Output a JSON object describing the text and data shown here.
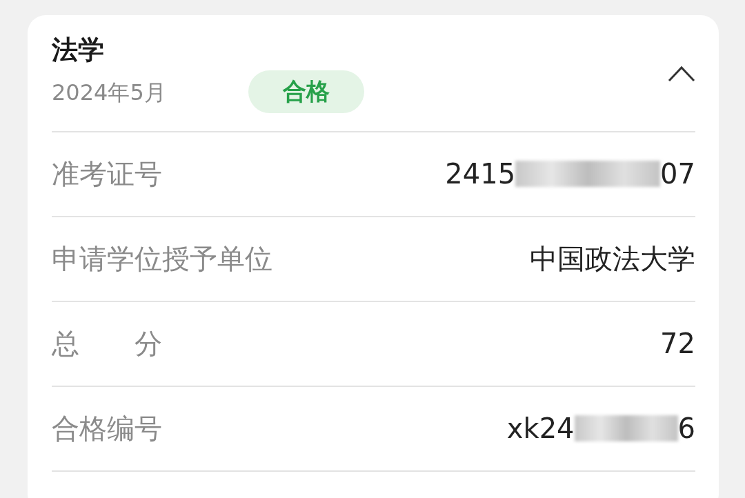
{
  "card": {
    "title": "法学",
    "date": "2024年5月",
    "badge": "合格",
    "expanded": true,
    "rows": [
      {
        "label": "准考证号",
        "value_start": "2415",
        "redacted": true,
        "value_end": "07"
      },
      {
        "label": "申请学位授予单位",
        "value_start": "中国政法大学",
        "redacted": false
      },
      {
        "label": "总　　分",
        "value_start": "72",
        "redacted": false
      },
      {
        "label": "合格编号",
        "value_start": "xk24",
        "redacted": true,
        "value_end": "6"
      }
    ]
  }
}
